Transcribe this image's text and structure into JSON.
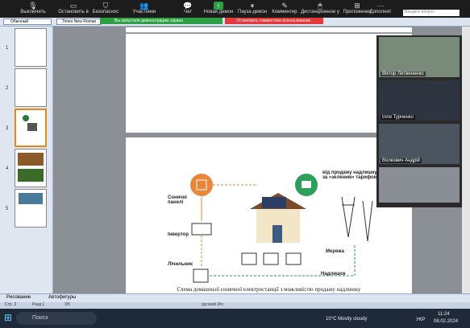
{
  "zoom": {
    "toolbar": [
      {
        "label": "Выключить",
        "icon": "microphone-icon"
      },
      {
        "label": "Остановить в",
        "icon": "camera-icon"
      },
      {
        "label": "Безопаснос",
        "icon": "shield-icon"
      },
      {
        "label": "Участники",
        "icon": "participants-icon"
      },
      {
        "label": "Чат",
        "icon": "chat-icon"
      },
      {
        "label": "Новая демон",
        "icon": "share-screen-icon"
      },
      {
        "label": "Пауза демон",
        "icon": "pause-icon"
      },
      {
        "label": "Комментир",
        "icon": "annotate-icon"
      },
      {
        "label": "Дистанционное у",
        "icon": "remote-control-icon"
      },
      {
        "label": "Приложения",
        "icon": "apps-icon"
      },
      {
        "label": "Дополнит",
        "icon": "more-icon"
      }
    ],
    "sharing_notice": "Вы запустили демонстрацию экрана",
    "stop_share": "Остановить совместное использование",
    "participants": [
      "Віктор Литвиненко",
      "Ілля Турченко",
      "Волкович Андрій",
      ""
    ]
  },
  "word": {
    "style": "Обычный",
    "font": "Times New Roman",
    "help_placeholder": "Введите вопрос",
    "autoshapes": "Автофигуры",
    "draw": "Рисование",
    "status_page": "Стр. 3",
    "status_section": "Разд 1",
    "status_pages": "3/5",
    "status_language": "русский (Ро"
  },
  "thumbs": [
    "1",
    "2",
    "3",
    "4",
    "5"
  ],
  "diagram": {
    "sale_label": "від продажу надлишку\nза «зеленим» тарифом",
    "panels_label": "Сонячні\nпанелі",
    "inverter_label": "Інвертор",
    "meter_label": "Лічильник",
    "grid_label": "Мережа",
    "surplus_label": "Надлишок"
  },
  "caption": "Схема домашньої сонячної електростанції з можливістю продажу надлишку",
  "taskbar": {
    "search": "Поиск",
    "weather": "10°C  Mostly cloudy",
    "lang": "УКР",
    "time": "11:24",
    "date": "08.02.2024"
  }
}
